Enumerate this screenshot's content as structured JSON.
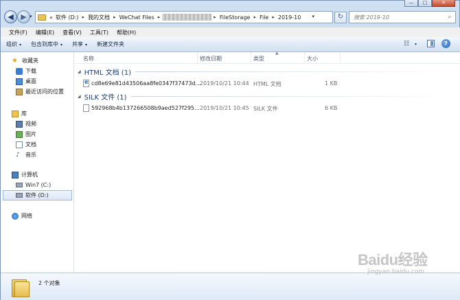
{
  "window": {
    "controls": [
      "—",
      "□",
      "✕"
    ]
  },
  "nav": {
    "back_glyph": "◀",
    "forward_glyph": "▶",
    "dropdown_glyph": "▾"
  },
  "address": {
    "prefix": "«",
    "crumbs": [
      "软件 (D:)",
      "我的文档",
      "WeChat Files",
      "",
      "FileStorage",
      "File",
      "2019-10"
    ],
    "dropdown_glyph": "▾",
    "refresh_glyph": "↻"
  },
  "search": {
    "placeholder": "搜索 2019-10",
    "icon": "⌕"
  },
  "menubar": {
    "items": [
      "文件(F)",
      "编辑(E)",
      "查看(V)",
      "工具(T)",
      "帮助(H)"
    ]
  },
  "cmdbar": {
    "organize": "组织",
    "include_library": "包含到库中",
    "share": "共享",
    "new_folder": "新建文件夹",
    "dropdown_glyph": "▾",
    "view_glyph": "☷",
    "help_glyph": "?"
  },
  "sidebar": {
    "favorites": {
      "label": "收藏夹",
      "items": [
        "下载",
        "桌面",
        "最近访问的位置"
      ]
    },
    "libraries": {
      "label": "库",
      "items": [
        "视频",
        "图片",
        "文档",
        "音乐"
      ]
    },
    "computer": {
      "label": "计算机",
      "items": [
        "Win7 (C:)",
        "软件 (D:)"
      ]
    },
    "network": {
      "label": "网络"
    },
    "star_glyph": "★",
    "music_glyph": "♪"
  },
  "columns": {
    "name": "名称",
    "modified": "修改日期",
    "type": "类型",
    "size": "大小",
    "sort_glyph": "▲"
  },
  "groups": [
    {
      "title": "HTML 文档 (1)",
      "files": [
        {
          "name": "cd8e69e81d43506aa8fe0347f37473d...",
          "modified": "2019/10/21 10:44",
          "type": "HTML 文档",
          "size": "1 KB"
        }
      ]
    },
    {
      "title": "SILK 文件 (1)",
      "files": [
        {
          "name": "592968b4b137266508b9aed527f295...",
          "modified": "2019/10/21 10:45",
          "type": "SILK 文件",
          "size": "6 KB"
        }
      ]
    }
  ],
  "group_toggle_glyph": "◢",
  "status": {
    "count": "2 个对象"
  },
  "watermark": {
    "main": "Baidu经验",
    "sub": "jingyan.baidu.com"
  }
}
